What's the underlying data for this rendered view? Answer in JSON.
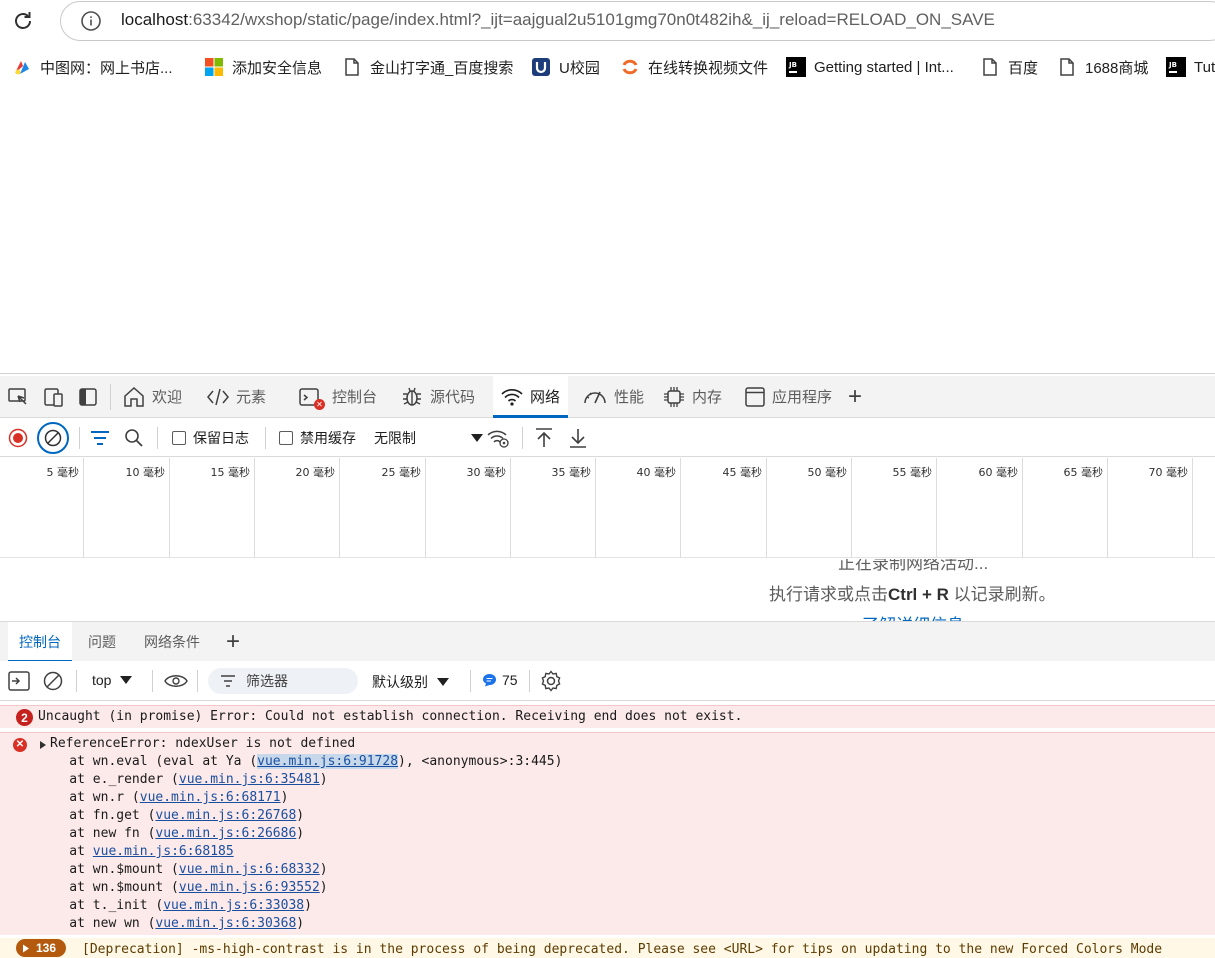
{
  "browser": {
    "url_host": "localhost",
    "url_rest": ":63342/wxshop/static/page/index.html?_ijt=aajgual2u5101gmg70n0t482ih&_ij_reload=RELOAD_ON_SAVE",
    "bookmarks": [
      {
        "label": "中图网：网上书店...",
        "icon": "zhongtu-icon"
      },
      {
        "label": "添加安全信息",
        "icon": "microsoft-icon"
      },
      {
        "label": "金山打字通_百度搜索",
        "icon": "page-icon"
      },
      {
        "label": "U校园",
        "icon": "u-icon"
      },
      {
        "label": "在线转换视频文件",
        "icon": "convert-icon"
      },
      {
        "label": "Getting started | Int...",
        "icon": "jetbrains-icon"
      },
      {
        "label": "百度",
        "icon": "page-icon"
      },
      {
        "label": "1688商城",
        "icon": "page-icon"
      },
      {
        "label": "Tut",
        "icon": "jetbrains-icon"
      }
    ]
  },
  "devtools": {
    "tabs": [
      {
        "label": "欢迎",
        "icon": "home-icon"
      },
      {
        "label": "元素",
        "icon": "code-icon"
      },
      {
        "label": "控制台",
        "icon": "console-icon"
      },
      {
        "label": "源代码",
        "icon": "bug-icon"
      },
      {
        "label": "网络",
        "icon": "wifi-icon",
        "active": true
      },
      {
        "label": "性能",
        "icon": "performance-icon"
      },
      {
        "label": "内存",
        "icon": "chip-icon"
      },
      {
        "label": "应用程序",
        "icon": "application-icon"
      }
    ],
    "add_tab": "+",
    "network": {
      "preserve_log": "保留日志",
      "disable_cache": "禁用缓存",
      "throttling": "无限制",
      "timeline_ticks": [
        "5 毫秒",
        "10 毫秒",
        "15 毫秒",
        "20 毫秒",
        "25 毫秒",
        "30 毫秒",
        "35 毫秒",
        "40 毫秒",
        "45 毫秒",
        "50 毫秒",
        "55 毫秒",
        "60 毫秒",
        "65 毫秒",
        "70 毫秒"
      ],
      "empty_top": "正在录制网络活动...",
      "empty_pre": "执行请求或点击",
      "empty_key1": "Ctrl",
      "empty_plus": " + ",
      "empty_key2": "R",
      "empty_post": " 以记录刷新。",
      "empty_link": "了解详细信息"
    },
    "drawer": {
      "tabs": [
        "控制台",
        "问题",
        "网络条件"
      ],
      "add": "+"
    },
    "console": {
      "context": "top",
      "filter_placeholder": "筛选器",
      "levels": "默认级别",
      "message_count": "75",
      "messages": {
        "error1": {
          "count": "2",
          "text": "Uncaught (in promise) Error: Could not establish connection. Receiving end does not exist."
        },
        "error2": {
          "head": "ReferenceError: ndexUser is not defined",
          "stack": [
            {
              "pre": "    at wn.eval (eval at Ya (",
              "link": "vue.min.js:6:91728",
              "post": "), <anonymous>:3:445)"
            },
            {
              "pre": "    at e._render (",
              "link": "vue.min.js:6:35481",
              "post": ")"
            },
            {
              "pre": "    at wn.r (",
              "link": "vue.min.js:6:68171",
              "post": ")"
            },
            {
              "pre": "    at fn.get (",
              "link": "vue.min.js:6:26768",
              "post": ")"
            },
            {
              "pre": "    at new fn (",
              "link": "vue.min.js:6:26686",
              "post": ")"
            },
            {
              "pre": "    at ",
              "link": "vue.min.js:6:68185",
              "post": ""
            },
            {
              "pre": "    at wn.$mount (",
              "link": "vue.min.js:6:68332",
              "post": ")"
            },
            {
              "pre": "    at wn.$mount (",
              "link": "vue.min.js:6:93552",
              "post": ")"
            },
            {
              "pre": "    at t._init (",
              "link": "vue.min.js:6:33038",
              "post": ")"
            },
            {
              "pre": "    at new wn (",
              "link": "vue.min.js:6:30368",
              "post": ")"
            }
          ]
        },
        "warning": {
          "count": "136",
          "text": "[Deprecation] -ms-high-contrast is in the process of being deprecated. Please see <URL> for tips on updating to the new Forced Colors Mode"
        }
      }
    }
  }
}
